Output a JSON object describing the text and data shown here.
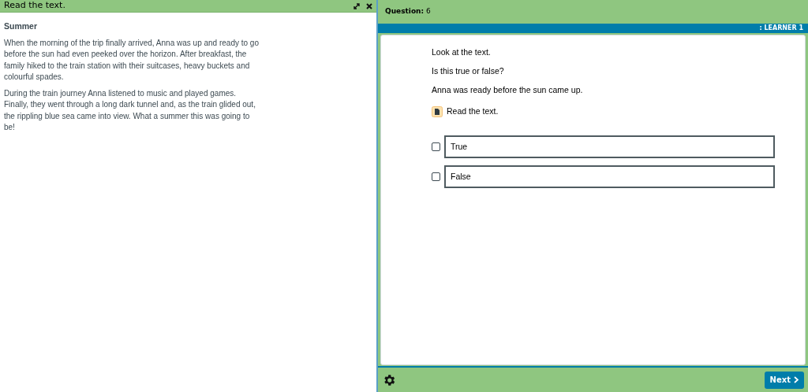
{
  "passage_panel": {
    "title": "Read the text.",
    "heading": "Summer",
    "paragraphs": [
      "When the morning of the trip finally arrived, Anna was up and ready to go before the sun had even peeked over the horizon. After breakfast, the family hiked to the train station with their suitcases, heavy buckets and colourful spades.",
      "During the train journey Anna listened to music and played games. Finally, they went through a long dark tunnel and, as the train glided out, the rippling blue sea came into view. What a summer this was going to be!"
    ]
  },
  "question_header": {
    "label": "Question:",
    "number": "6"
  },
  "learner_bar": ": LEARNER 1",
  "question": {
    "prompts": [
      "Look at the text.",
      "Is this true or false?",
      "Anna was ready before the sun came up."
    ],
    "resource_link": "Read the text."
  },
  "options": [
    {
      "label": "True",
      "selected": false
    },
    {
      "label": "False",
      "selected": false
    }
  ],
  "footer": {
    "next_button": "Next"
  }
}
